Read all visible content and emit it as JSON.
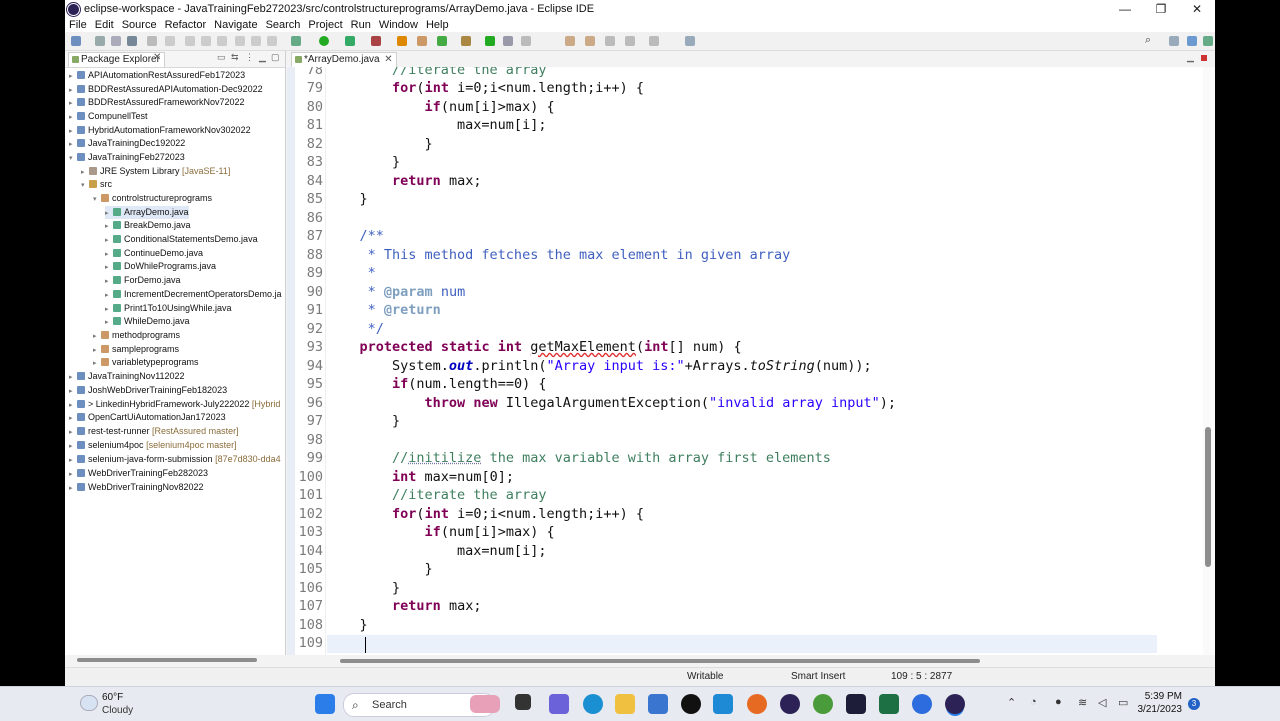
{
  "window": {
    "title": "eclipse-workspace - JavaTrainingFeb272023/src/controlstructureprograms/ArrayDemo.java - Eclipse IDE",
    "minimize": "—",
    "maximize": "❐",
    "close": "✕"
  },
  "menu": [
    "File",
    "Edit",
    "Source",
    "Refactor",
    "Navigate",
    "Search",
    "Project",
    "Run",
    "Window",
    "Help"
  ],
  "package_explorer": {
    "tab_label": "Package Explorer",
    "close": "✕",
    "items": [
      {
        "label": "APIAutomationRestAssuredFeb172023",
        "deco": ""
      },
      {
        "label": "BDDRestAssuredAPIAutomation-Dec92022",
        "deco": ""
      },
      {
        "label": "BDDRestAssuredFrameworkNov72022",
        "deco": ""
      },
      {
        "label": "CompunellTest",
        "deco": ""
      },
      {
        "label": "HybridAutomationFrameworkNov302022",
        "deco": ""
      },
      {
        "label": "JavaTrainingDec192022",
        "deco": ""
      },
      {
        "label": "JavaTrainingFeb272023",
        "deco": ""
      },
      {
        "label": "JRE System Library",
        "deco": "[JavaSE-11]"
      },
      {
        "label": "src",
        "deco": ""
      },
      {
        "label": "controlstructureprograms",
        "deco": ""
      },
      {
        "label": "ArrayDemo.java",
        "deco": ""
      },
      {
        "label": "BreakDemo.java",
        "deco": ""
      },
      {
        "label": "ConditionalStatementsDemo.java",
        "deco": ""
      },
      {
        "label": "ContinueDemo.java",
        "deco": ""
      },
      {
        "label": "DoWhilePrograms.java",
        "deco": ""
      },
      {
        "label": "ForDemo.java",
        "deco": ""
      },
      {
        "label": "IncrementDecrementOperatorsDemo.ja",
        "deco": ""
      },
      {
        "label": "Print1To10UsingWhile.java",
        "deco": ""
      },
      {
        "label": "WhileDemo.java",
        "deco": ""
      },
      {
        "label": "methodprograms",
        "deco": ""
      },
      {
        "label": "sampleprograms",
        "deco": ""
      },
      {
        "label": "variabletypeprograms",
        "deco": ""
      },
      {
        "label": "JavaTrainingNov112022",
        "deco": ""
      },
      {
        "label": "JoshWebDriverTrainingFeb182023",
        "deco": ""
      },
      {
        "label": "> LinkedinHybridFramework-July222022",
        "deco": "[Hybrid"
      },
      {
        "label": "OpenCartUiAutomationJan172023",
        "deco": ""
      },
      {
        "label": "rest-test-runner",
        "deco": "[RestAssured master]"
      },
      {
        "label": "selenium4poc",
        "deco": "[selenium4poc master]"
      },
      {
        "label": "selenium-java-form-submission",
        "deco": "[87e7d830-dda4"
      },
      {
        "label": "WebDriverTrainingFeb282023",
        "deco": ""
      },
      {
        "label": "WebDriverTrainingNov82022",
        "deco": ""
      }
    ]
  },
  "editor": {
    "tab_label": "*ArrayDemo.java",
    "tab_close": "✕",
    "line_numbers": [
      "78",
      "79",
      "80",
      "81",
      "82",
      "83",
      "84",
      "85",
      "86",
      "87",
      "88",
      "89",
      "90",
      "91",
      "92",
      "93",
      "94",
      "95",
      "96",
      "97",
      "98",
      "99",
      "100",
      "101",
      "102",
      "103",
      "104",
      "105",
      "106",
      "107",
      "108",
      "109"
    ],
    "code": {
      "l78": "        //iterate the array",
      "l79a": "        ",
      "l79b": "for",
      "l79c": "(",
      "l79d": "int",
      "l79e": " i=0;i<num.length;i++) {",
      "l80a": "            ",
      "l80b": "if",
      "l80c": "(num[i]>max) {",
      "l81": "                max=num[i];",
      "l82": "            }",
      "l83": "        }",
      "l84a": "        ",
      "l84b": "return",
      "l84c": " max;",
      "l85": "    }",
      "l86": "",
      "l87": "    /**",
      "l88": "     * This method fetches the max element in given array",
      "l89": "     *",
      "l90a": "     * ",
      "l90b": "@param",
      "l90c": " num",
      "l91a": "     * ",
      "l91b": "@return",
      "l92": "     */",
      "l93a": "    ",
      "l93b": "protected",
      "l93c": " ",
      "l93d": "static",
      "l93e": " ",
      "l93f": "int",
      "l93g": " ",
      "l93h": "getMaxElement",
      "l93i": "(",
      "l93j": "int",
      "l93k": "[] num) {",
      "l94a": "        System.",
      "l94b": "out",
      "l94c": ".println(",
      "l94d": "\"Array input is:\"",
      "l94e": "+Arrays.",
      "l94f": "toString",
      "l94g": "(num));",
      "l95a": "        ",
      "l95b": "if",
      "l95c": "(num.length==0) {",
      "l96a": "            ",
      "l96b": "throw",
      "l96c": " ",
      "l96d": "new",
      "l96e": " IllegalArgumentException(",
      "l96f": "\"invalid array input\"",
      "l96g": ");",
      "l97": "        }",
      "l98": "",
      "l99a": "        //",
      "l99b": "initilize",
      "l99c": " the max variable with array first elements",
      "l100a": "        ",
      "l100b": "int",
      "l100c": " max=num[0];",
      "l101": "        //iterate the array",
      "l102a": "        ",
      "l102b": "for",
      "l102c": "(",
      "l102d": "int",
      "l102e": " i=0;i<num.length;i++) {",
      "l103a": "            ",
      "l103b": "if",
      "l103c": "(num[i]>max) {",
      "l104": "                max=num[i];",
      "l105": "            }",
      "l106": "        }",
      "l107a": "        ",
      "l107b": "return",
      "l107c": " max;",
      "l108": "    }",
      "l109": ""
    }
  },
  "status": {
    "writable": "Writable",
    "insert_mode": "Smart Insert",
    "position": "109 : 5 : 2877"
  },
  "taskbar": {
    "temperature": "60°F",
    "weather": "Cloudy",
    "search_label": "Search",
    "time": "5:39 PM",
    "date": "3/21/2023",
    "notification_count": "3"
  }
}
